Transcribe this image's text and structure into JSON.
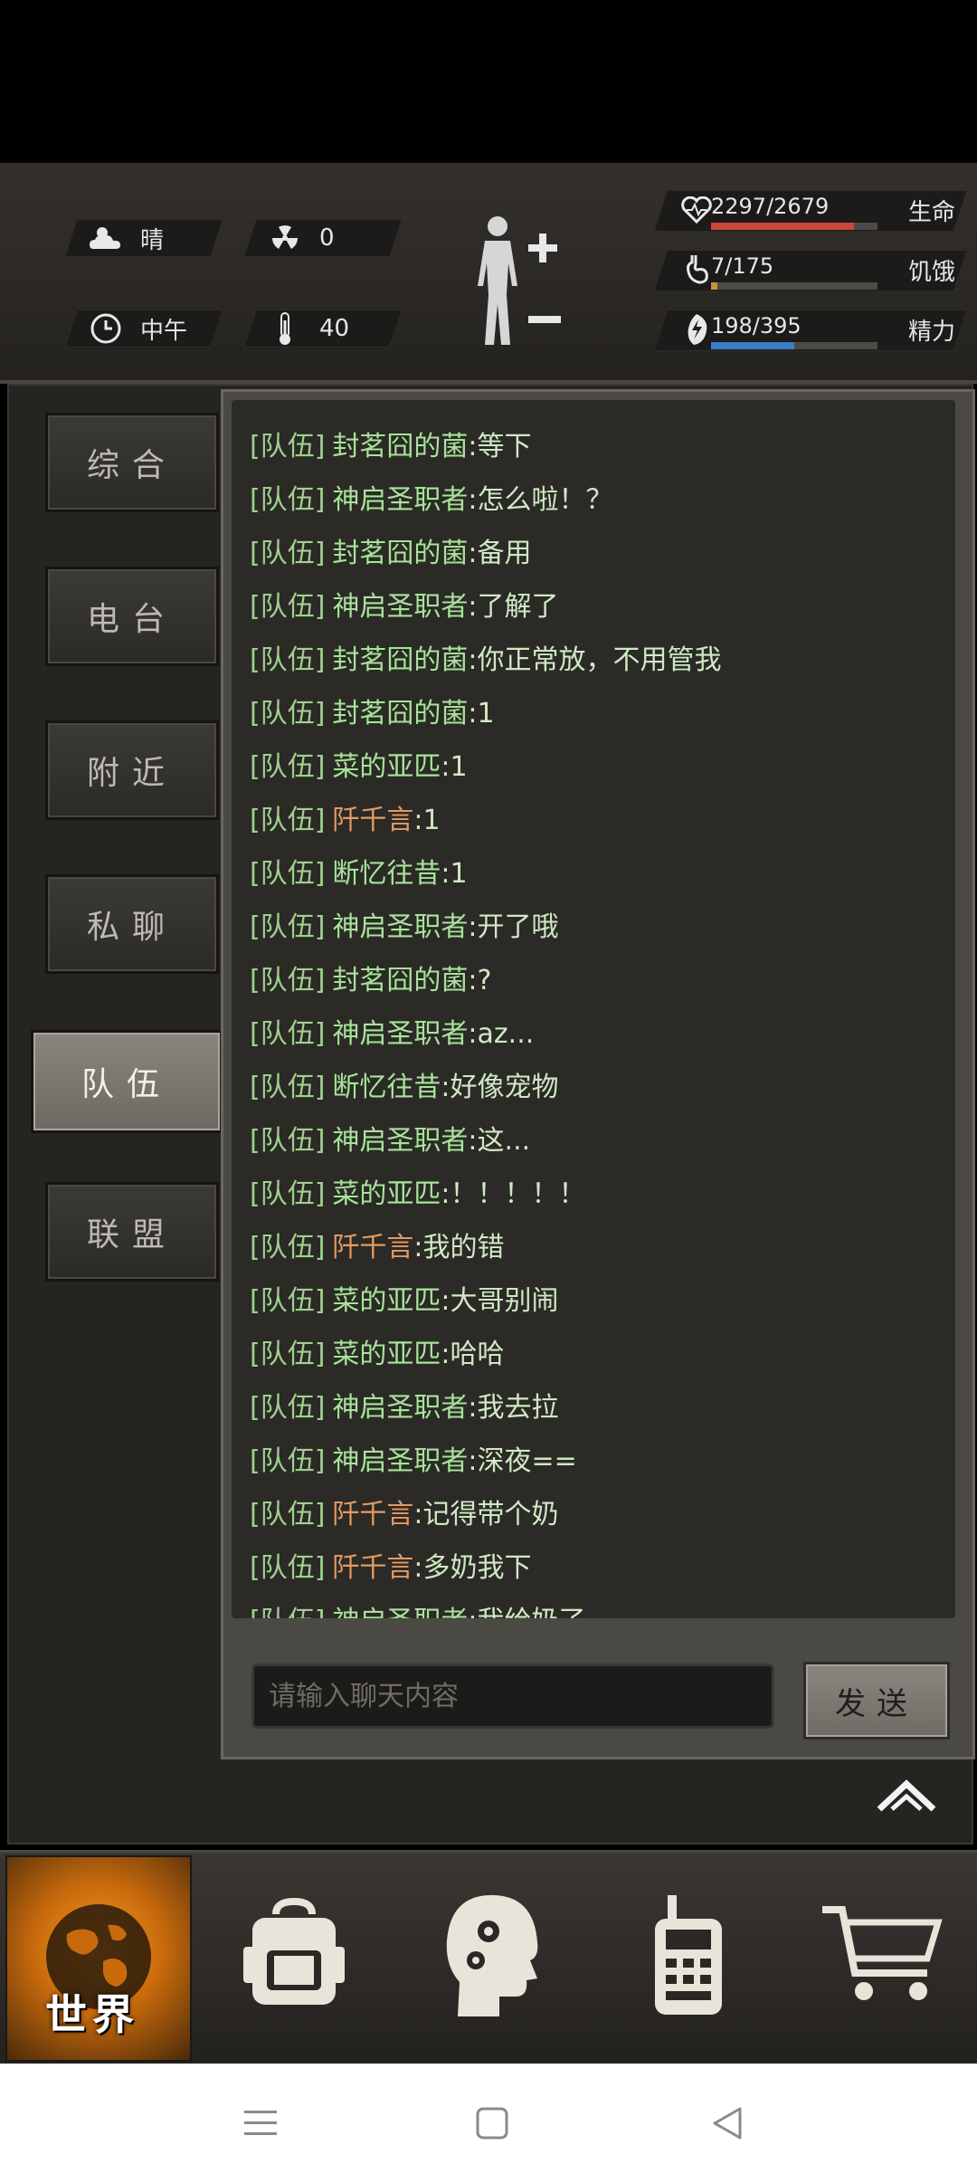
{
  "hud": {
    "weather": {
      "icon": "weather-cloud-sun-icon",
      "label": "晴"
    },
    "radiation": {
      "icon": "radiation-icon",
      "value": "0"
    },
    "time": {
      "icon": "clock-icon",
      "label": "中午"
    },
    "temperature": {
      "icon": "thermometer-icon",
      "value": "40"
    },
    "body_status": {
      "icon": "human-figure-icon",
      "plus_icon": "plus-icon",
      "minus_icon": "minus-icon"
    },
    "stats": [
      {
        "icon": "heart-icon",
        "value": "2297/2679",
        "label": "生命",
        "fraction": 0.858,
        "color": "#c9483b"
      },
      {
        "icon": "stomach-icon",
        "value": "7/175",
        "label": "饥饿",
        "fraction": 0.04,
        "color": "#c9913b"
      },
      {
        "icon": "energy-icon",
        "value": "198/395",
        "label": "精力",
        "fraction": 0.5,
        "color": "#3b7fc9"
      }
    ]
  },
  "tabs": [
    {
      "label": "综合",
      "active": false
    },
    {
      "label": "电台",
      "active": false
    },
    {
      "label": "附近",
      "active": false
    },
    {
      "label": "私聊",
      "active": false
    },
    {
      "label": "队伍",
      "active": true
    },
    {
      "label": "联盟",
      "active": false
    }
  ],
  "chat": {
    "messages": [
      {
        "channel": "[队伍]",
        "name": "封茗囧的菌",
        "text": ":等下",
        "highlight": false
      },
      {
        "channel": "[队伍]",
        "name": "神启圣职者",
        "text": ":怎么啦！？",
        "highlight": false
      },
      {
        "channel": "[队伍]",
        "name": "封茗囧的菌",
        "text": ":备用",
        "highlight": false
      },
      {
        "channel": "[队伍]",
        "name": "神启圣职者",
        "text": ":了解了",
        "highlight": false
      },
      {
        "channel": "[队伍]",
        "name": "封茗囧的菌",
        "text": ":你正常放，不用管我",
        "highlight": false
      },
      {
        "channel": "[队伍]",
        "name": "封茗囧的菌",
        "text": ":1",
        "highlight": false
      },
      {
        "channel": "[队伍]",
        "name": "菜的亚匹",
        "text": ":1",
        "highlight": false
      },
      {
        "channel": "[队伍]",
        "name": "阡千言",
        "text": ":1",
        "highlight": true
      },
      {
        "channel": "[队伍]",
        "name": "断忆往昔",
        "text": ":1",
        "highlight": false
      },
      {
        "channel": "[队伍]",
        "name": "神启圣职者",
        "text": ":开了哦",
        "highlight": false
      },
      {
        "channel": "[队伍]",
        "name": "封茗囧的菌",
        "text": ":?",
        "highlight": false
      },
      {
        "channel": "[队伍]",
        "name": "神启圣职者",
        "text": ":az...",
        "highlight": false
      },
      {
        "channel": "[队伍]",
        "name": "断忆往昔",
        "text": ":好像宠物",
        "highlight": false
      },
      {
        "channel": "[队伍]",
        "name": "神启圣职者",
        "text": ":这...",
        "highlight": false
      },
      {
        "channel": "[队伍]",
        "name": "菜的亚匹",
        "text": ":！！！！！",
        "highlight": false
      },
      {
        "channel": "[队伍]",
        "name": "阡千言",
        "text": ":我的错",
        "highlight": true
      },
      {
        "channel": "[队伍]",
        "name": "菜的亚匹",
        "text": ":大哥别闹",
        "highlight": false
      },
      {
        "channel": "[队伍]",
        "name": "菜的亚匹",
        "text": ":哈哈",
        "highlight": false
      },
      {
        "channel": "[队伍]",
        "name": "神启圣职者",
        "text": ":我去拉",
        "highlight": false
      },
      {
        "channel": "[队伍]",
        "name": "神启圣职者",
        "text": ":深夜==",
        "highlight": false
      },
      {
        "channel": "[队伍]",
        "name": "阡千言",
        "text": ":记得带个奶",
        "highlight": true
      },
      {
        "channel": "[队伍]",
        "name": "阡千言",
        "text": ":多奶我下",
        "highlight": true
      },
      {
        "channel": "[队伍]",
        "name": "神启圣职者",
        "text": ":我给奶了",
        "highlight": false
      }
    ],
    "input_placeholder": "请输入聊天内容",
    "send_label": "发送"
  },
  "bottom_nav": {
    "world_label": "世界",
    "items": [
      {
        "icon": "globe-icon",
        "name": "nav-world"
      },
      {
        "icon": "backpack-icon",
        "name": "nav-backpack"
      },
      {
        "icon": "head-gears-icon",
        "name": "nav-skills"
      },
      {
        "icon": "walkie-talkie-icon",
        "name": "nav-radio"
      },
      {
        "icon": "shopping-cart-icon",
        "name": "nav-shop"
      }
    ]
  },
  "system_nav": [
    "menu-icon",
    "home-square-icon",
    "back-triangle-icon"
  ]
}
